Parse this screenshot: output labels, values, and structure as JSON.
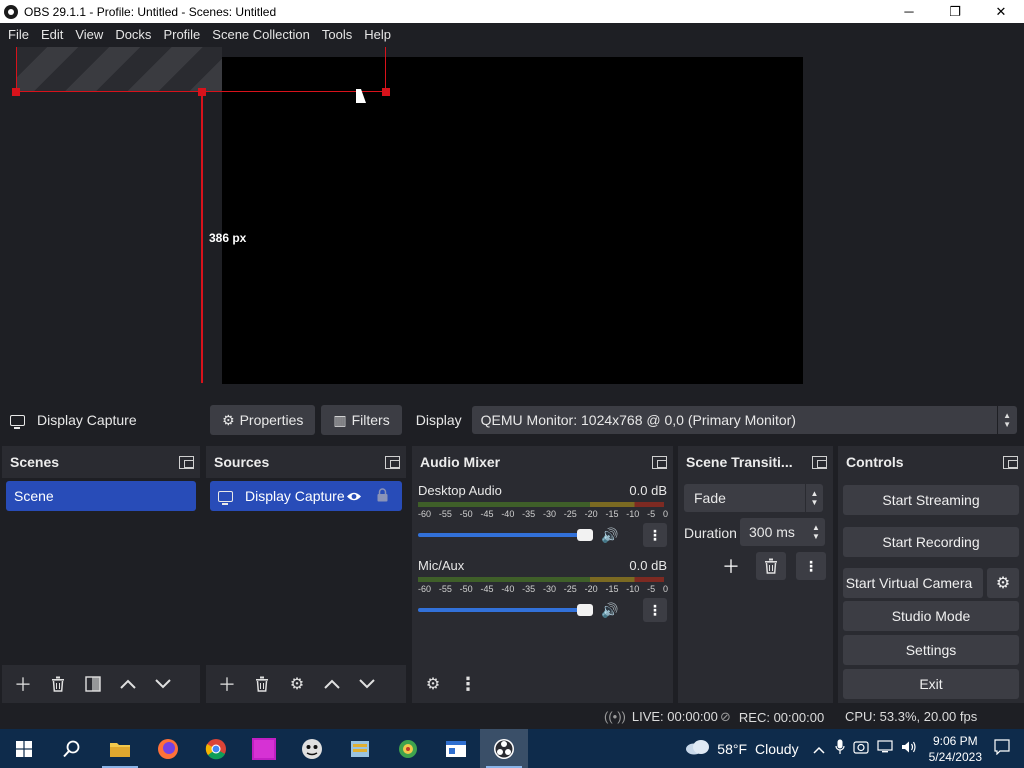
{
  "window": {
    "title": "OBS 29.1.1 - Profile: Untitled - Scenes: Untitled",
    "minimize": "─",
    "maximize": "❐",
    "close": "✕"
  },
  "menu": [
    "File",
    "Edit",
    "View",
    "Docks",
    "Profile",
    "Scene Collection",
    "Tools",
    "Help"
  ],
  "preview": {
    "measurement": "386 px"
  },
  "source_toolbar": {
    "source_name": "Display Capture",
    "properties_label": "Properties",
    "filters_label": "Filters",
    "display_label": "Display",
    "display_value": "QEMU Monitor: 1024x768 @ 0,0 (Primary Monitor)"
  },
  "scenes": {
    "title": "Scenes",
    "items": [
      "Scene"
    ]
  },
  "sources": {
    "title": "Sources",
    "items": [
      "Display Capture"
    ]
  },
  "mixer": {
    "title": "Audio Mixer",
    "ticks": [
      "-60",
      "-55",
      "-50",
      "-45",
      "-40",
      "-35",
      "-30",
      "-25",
      "-20",
      "-15",
      "-10",
      "-5",
      "0"
    ],
    "channels": [
      {
        "name": "Desktop Audio",
        "db": "0.0 dB",
        "volume": 1.0
      },
      {
        "name": "Mic/Aux",
        "db": "0.0 dB",
        "volume": 1.0
      }
    ]
  },
  "transitions": {
    "title": "Scene Transiti...",
    "selected": "Fade",
    "duration_label": "Duration",
    "duration_value": "300 ms"
  },
  "controls": {
    "title": "Controls",
    "start_streaming": "Start Streaming",
    "start_recording": "Start Recording",
    "start_virtual_camera": "Start Virtual Camera",
    "studio_mode": "Studio Mode",
    "settings": "Settings",
    "exit": "Exit"
  },
  "status": {
    "live": "LIVE: 00:00:00",
    "rec": "REC: 00:00:00",
    "cpu": "CPU: 53.3%, 20.00 fps"
  },
  "taskbar": {
    "weather_temp": "58°F",
    "weather_desc": "Cloudy",
    "time": "9:06 PM",
    "date": "5/24/2023"
  }
}
